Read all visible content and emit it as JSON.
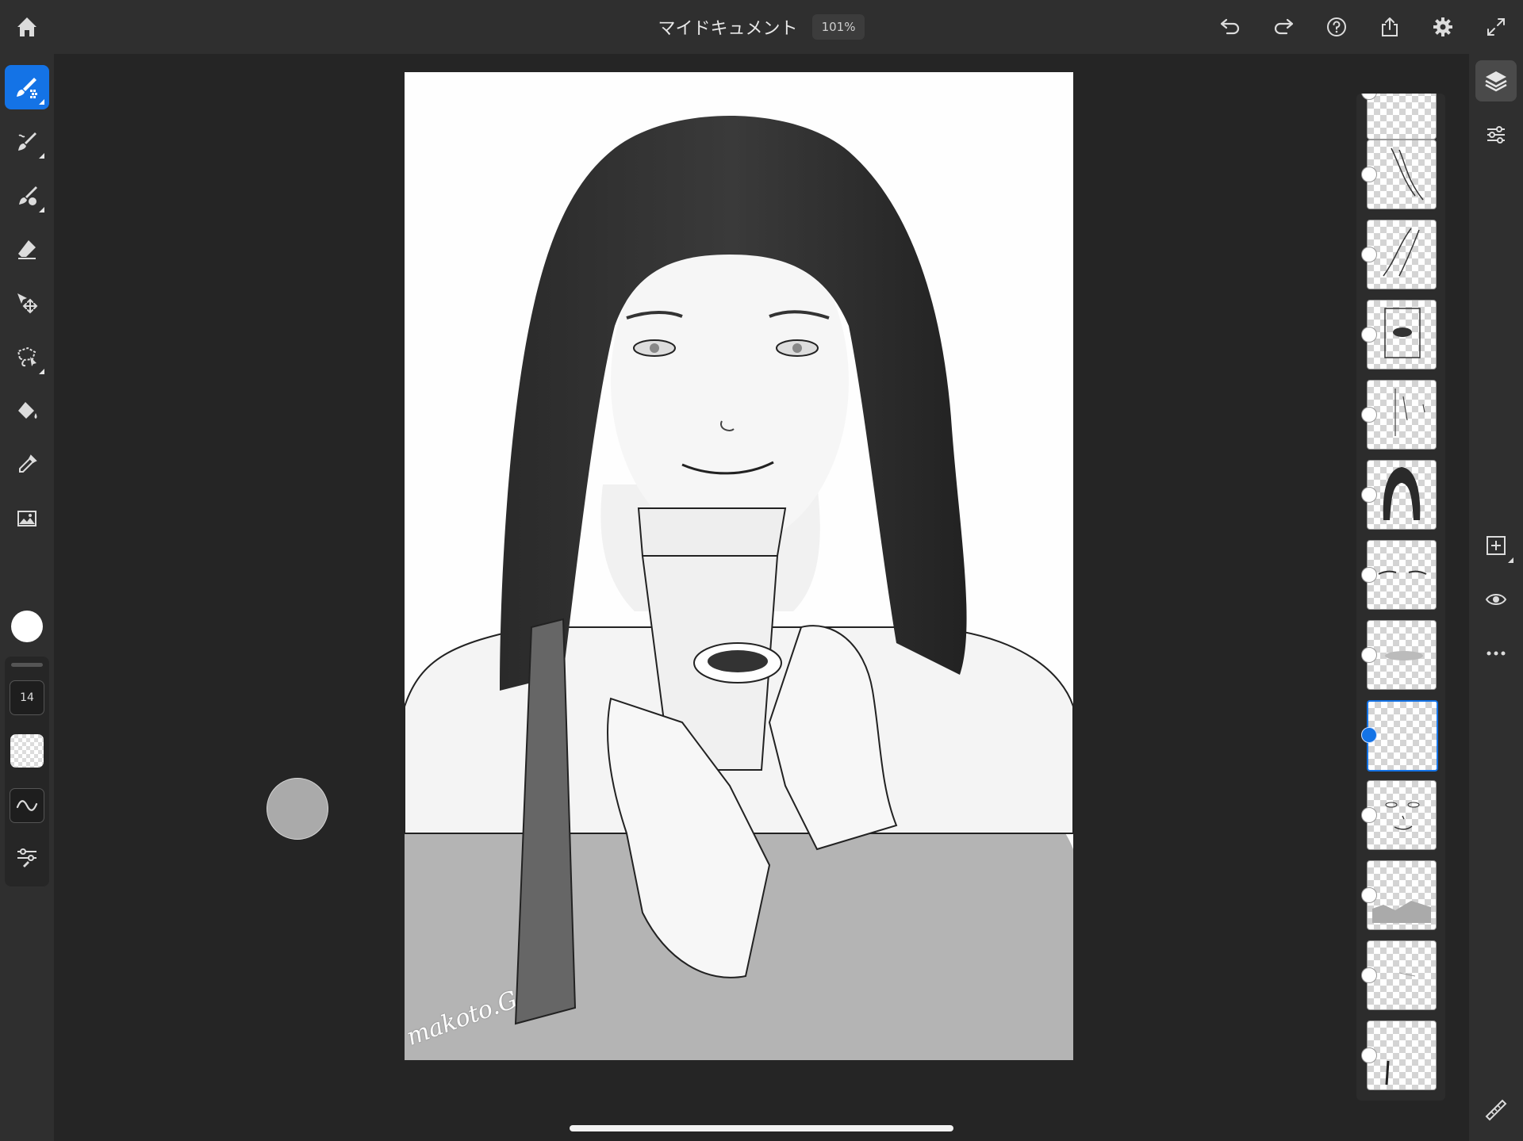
{
  "document": {
    "title": "マイドキュメント",
    "zoom": "101%"
  },
  "top_bar": {
    "icons": [
      "home-icon",
      "undo-icon",
      "redo-icon",
      "help-icon",
      "share-icon",
      "settings-icon",
      "fullscreen-icon"
    ]
  },
  "tools": [
    {
      "name": "pixel-brush-tool",
      "icon": "pixel-brush-icon",
      "active": true
    },
    {
      "name": "live-brush-tool",
      "icon": "live-brush-icon"
    },
    {
      "name": "mixer-brush-tool",
      "icon": "mixer-brush-icon"
    },
    {
      "name": "eraser-tool",
      "icon": "eraser-icon"
    },
    {
      "name": "move-tool",
      "icon": "move-icon"
    },
    {
      "name": "lasso-tool",
      "icon": "lasso-icon"
    },
    {
      "name": "fill-tool",
      "icon": "paint-bucket-icon"
    },
    {
      "name": "eyedropper-tool",
      "icon": "eyedropper-icon"
    },
    {
      "name": "place-image-tool",
      "icon": "image-icon"
    }
  ],
  "brush": {
    "color": "#ffffff",
    "size": "14",
    "settings_icon": "brush-settings-icon",
    "smoothing_icon": "smoothing-icon"
  },
  "layers": {
    "count": 13,
    "selected_index": 8
  },
  "right_rail": {
    "icons": [
      "layers-icon",
      "adjustments-icon",
      "add-layer-icon",
      "visibility-icon",
      "more-icon",
      "ruler-icon"
    ]
  },
  "canvas": {
    "signature": "makoto.G"
  },
  "colors": {
    "accent": "#1473e6",
    "bar": "#2f2f2f",
    "workspace": "#252525"
  }
}
